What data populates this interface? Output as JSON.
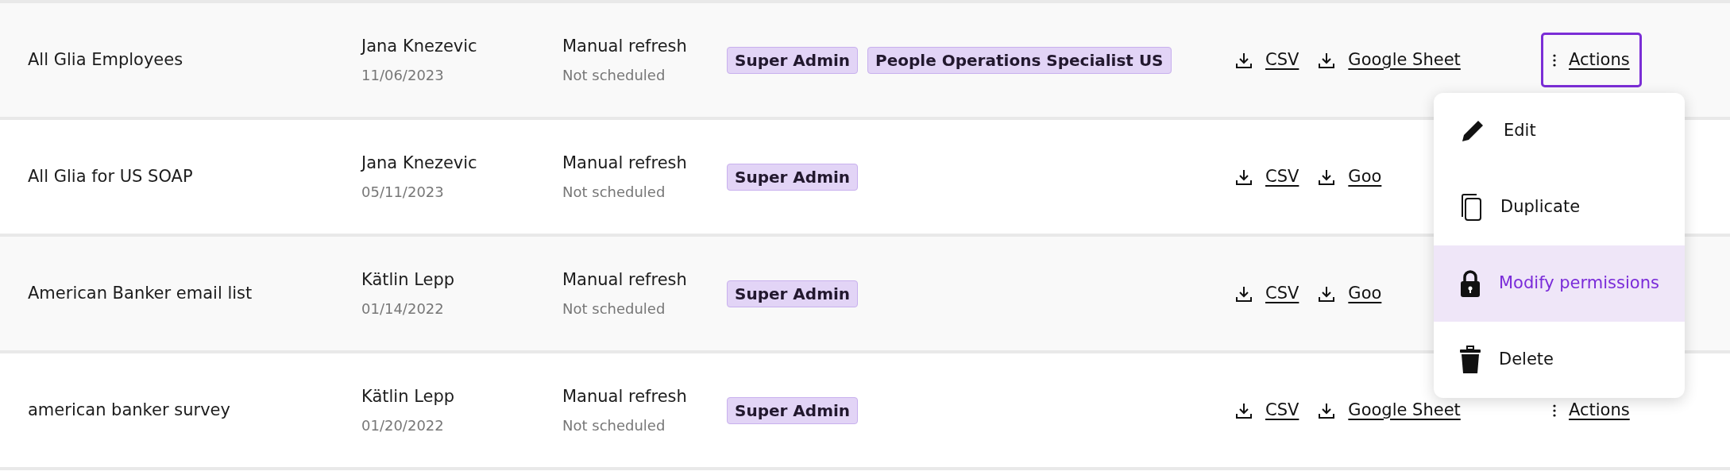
{
  "rows": [
    {
      "name": "All Glia Employees",
      "owner": "Jana Knezevic",
      "date": "11/06/2023",
      "refresh": "Manual refresh",
      "schedule": "Not scheduled",
      "tags": [
        "Super Admin",
        "People Operations Specialist US"
      ],
      "exports": [
        "CSV",
        "Google Sheet"
      ],
      "actions": {
        "label": "Actions",
        "focused": true
      }
    },
    {
      "name": "All Glia for US SOAP",
      "owner": "Jana Knezevic",
      "date": "05/11/2023",
      "refresh": "Manual refresh",
      "schedule": "Not scheduled",
      "tags": [
        "Super Admin"
      ],
      "exports": [
        "CSV",
        "Goo"
      ]
    },
    {
      "name": "American Banker email list",
      "owner": "Kätlin Lepp",
      "date": "01/14/2022",
      "refresh": "Manual refresh",
      "schedule": "Not scheduled",
      "tags": [
        "Super Admin"
      ],
      "exports": [
        "CSV",
        "Goo"
      ]
    },
    {
      "name": "american banker survey",
      "owner": "Kätlin Lepp",
      "date": "01/20/2022",
      "refresh": "Manual refresh",
      "schedule": "Not scheduled",
      "tags": [
        "Super Admin"
      ],
      "exports": [
        "CSV",
        "Google Sheet"
      ],
      "actions": {
        "label": "Actions",
        "focused": false
      }
    }
  ],
  "menu": {
    "items": [
      {
        "kind": "edit",
        "label": "Edit",
        "selected": false
      },
      {
        "kind": "duplicate",
        "label": "Duplicate",
        "selected": false
      },
      {
        "kind": "permissions",
        "label": "Modify permissions",
        "selected": true
      },
      {
        "kind": "delete",
        "label": "Delete",
        "selected": false
      }
    ]
  }
}
